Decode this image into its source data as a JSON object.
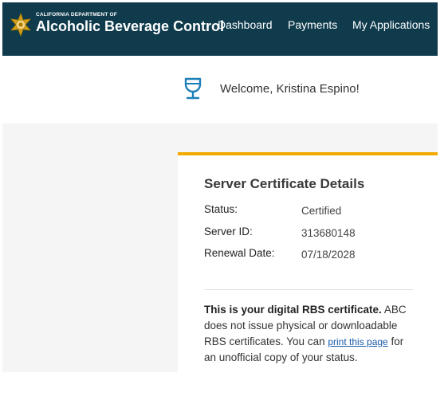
{
  "header": {
    "brand_small": "CALIFORNIA DEPARTMENT OF",
    "brand_big": "Alcoholic Beverage Control",
    "nav": {
      "dashboard": "Dashboard",
      "payments": "Payments",
      "applications": "My Applications"
    },
    "colors": {
      "background": "#0f3b4d",
      "seal": "#d4a017"
    },
    "icons": {
      "seal": "state-seal-icon"
    }
  },
  "welcome": {
    "icon": "wine-glass-icon",
    "text": "Welcome, Kristina Espino!",
    "icon_color": "#1c7fb8"
  },
  "card": {
    "accent_color": "#f2a900",
    "title": "Server Certificate Details",
    "rows": [
      {
        "label": "Status:",
        "value": "Certified"
      },
      {
        "label": "Server ID:",
        "value": "313680148"
      },
      {
        "label": "Renewal Date:",
        "value": "07/18/2028"
      }
    ],
    "note": {
      "bold": "This is your digital RBS certificate.",
      "text_before_link": " ABC does not issue physical or downloadable RBS certificates. You can ",
      "link": "print this page",
      "text_after_link": " for an unofficial copy of your status."
    }
  }
}
